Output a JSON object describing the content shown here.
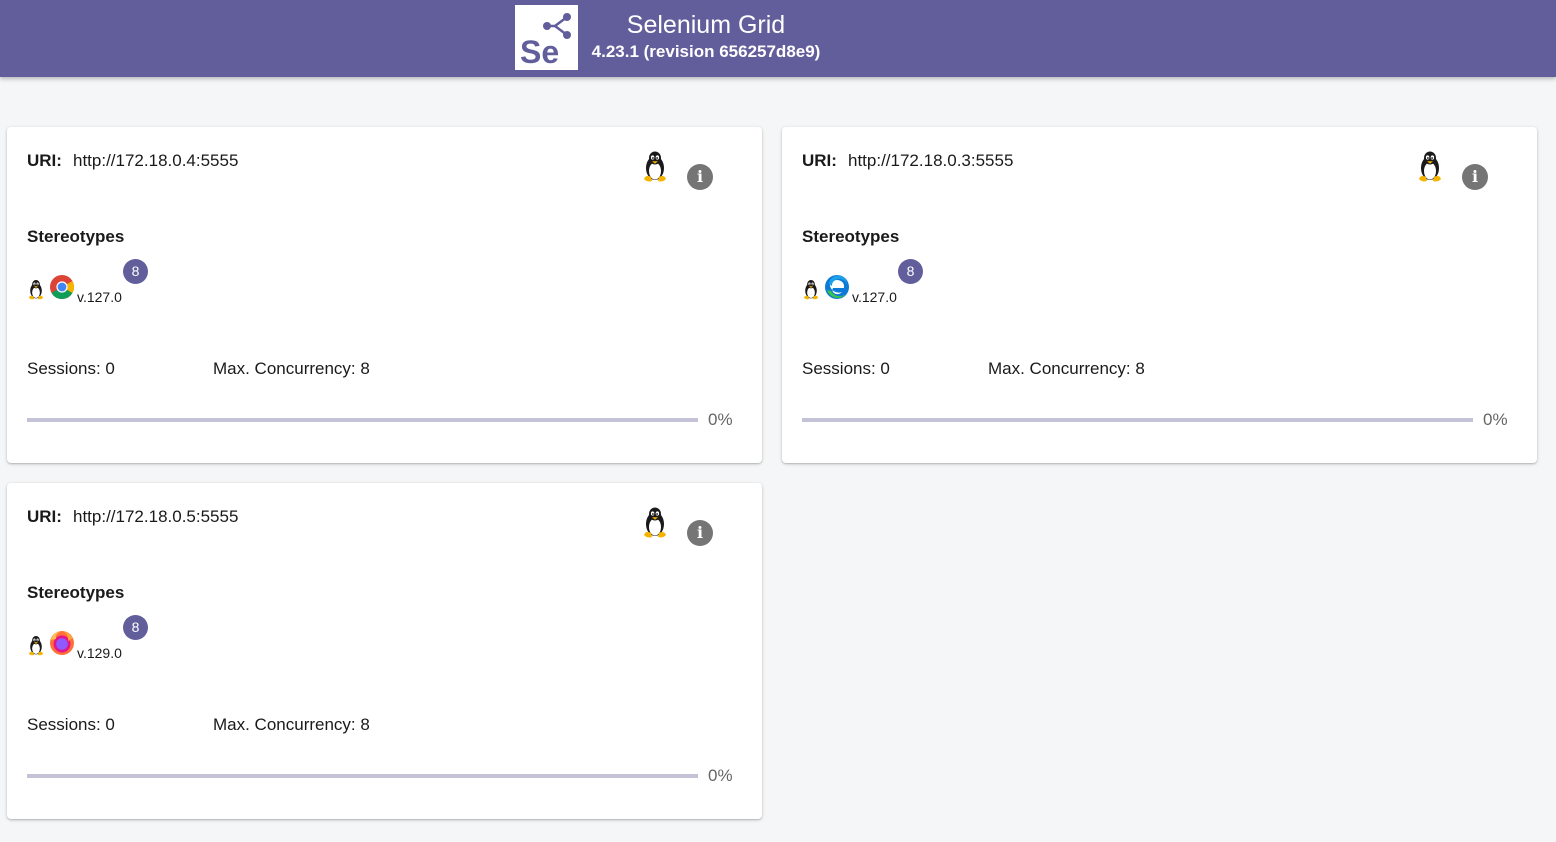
{
  "header": {
    "title": "Selenium Grid",
    "version": "4.23.1 (revision 656257d8e9)",
    "logo_text": "Se",
    "background_color": "#615e9b"
  },
  "nodes": [
    {
      "uri_label": "URI:",
      "uri": "http://172.18.0.4:5555",
      "os_icon": "linux-tux-icon",
      "info_icon": "info-icon",
      "stereotypes_heading": "Stereotypes",
      "stereotype": {
        "os_icon": "linux-tux-icon",
        "browser_icon": "chrome-icon",
        "browser_version": "v.127.0",
        "slots": "8"
      },
      "sessions_text": "Sessions: 0",
      "concurrency_text": "Max. Concurrency: 8",
      "progress_percent": 0,
      "progress_label": "0%"
    },
    {
      "uri_label": "URI:",
      "uri": "http://172.18.0.3:5555",
      "os_icon": "linux-tux-icon",
      "info_icon": "info-icon",
      "stereotypes_heading": "Stereotypes",
      "stereotype": {
        "os_icon": "linux-tux-icon",
        "browser_icon": "edge-icon",
        "browser_version": "v.127.0",
        "slots": "8"
      },
      "sessions_text": "Sessions: 0",
      "concurrency_text": "Max. Concurrency: 8",
      "progress_percent": 0,
      "progress_label": "0%"
    },
    {
      "uri_label": "URI:",
      "uri": "http://172.18.0.5:5555",
      "os_icon": "linux-tux-icon",
      "info_icon": "info-icon",
      "stereotypes_heading": "Stereotypes",
      "stereotype": {
        "os_icon": "linux-tux-icon",
        "browser_icon": "firefox-icon",
        "browser_version": "v.129.0",
        "slots": "8"
      },
      "sessions_text": "Sessions: 0",
      "concurrency_text": "Max. Concurrency: 8",
      "progress_percent": 0,
      "progress_label": "0%"
    }
  ]
}
